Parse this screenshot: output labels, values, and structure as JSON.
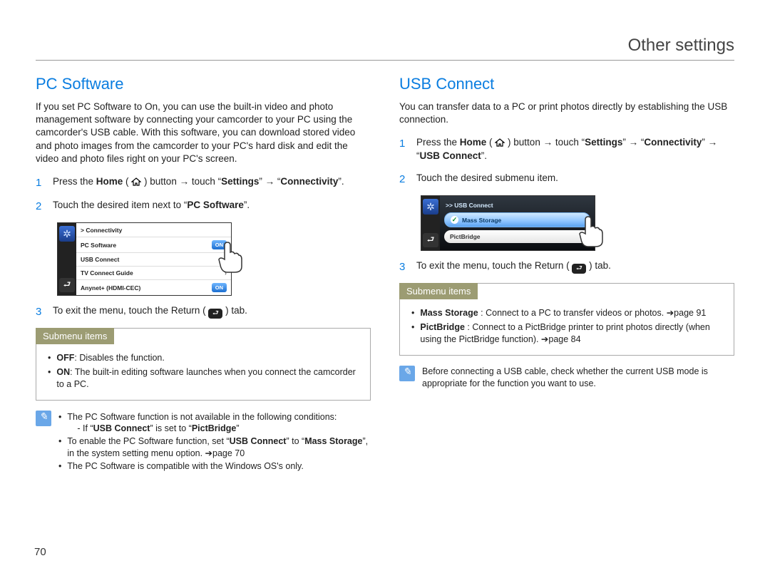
{
  "header": {
    "title": "Other settings"
  },
  "page_number": "70",
  "left": {
    "title": "PC Software",
    "intro": "If you set PC Software to On, you can use the built-in video and photo management software by connecting your camcorder to your PC using the camcorder's USB cable. With this software, you can download stored video and photo images from the camcorder to your PC's hard disk and edit the video and photo files right on your PC's screen.",
    "steps": {
      "s1_num": "1",
      "s1_a": "Press the ",
      "s1_home": "Home",
      "s1_b": " ( ",
      "s1_c": " ) button → touch “",
      "s1_settings": "Settings",
      "s1_d": "” → “",
      "s1_conn": "Connectivity",
      "s1_e": "”.",
      "s2_num": "2",
      "s2_a": "Touch the desired item next to “",
      "s2_pc": "PC Software",
      "s2_b": "”.",
      "s3_num": "3",
      "s3_a": "To exit the menu, touch the Return ( ",
      "s3_b": " ) tab."
    },
    "menu": {
      "crumb": "> Connectivity",
      "rows": {
        "r1": "PC Software",
        "r1_badge": "ON",
        "r2": "USB Connect",
        "r3": "TV Connect Guide",
        "r4": "Anynet+ (HDMI-CEC)",
        "r4_badge": "ON"
      }
    },
    "submenu": {
      "tab": "Submenu items",
      "off_label": "OFF",
      "off_text": ": Disables the function.",
      "on_label": "ON",
      "on_text": ": The built-in editing software launches when you connect the camcorder to a PC."
    },
    "notes": {
      "n1": "The PC Software function is not available in the following conditions:",
      "n1sub_a": "- If “",
      "n1sub_usb": "USB Connect",
      "n1sub_b": "” is set to “",
      "n1sub_pb": "PictBridge",
      "n1sub_c": "”",
      "n2_a": "To enable the PC Software function, set “",
      "n2_usb": "USB Connect",
      "n2_b": "” to “",
      "n2_mass": "Mass Storage",
      "n2_c": "”, in the system setting menu option. ➔page 70",
      "n3": "The PC Software is compatible with the Windows OS's only."
    }
  },
  "right": {
    "title": "USB Connect",
    "intro": "You can transfer data to a PC or print photos directly by establishing the USB connection.",
    "steps": {
      "s1_num": "1",
      "s1_a": "Press the ",
      "s1_home": "Home",
      "s1_b": " ( ",
      "s1_c": " ) button → touch “",
      "s1_settings": "Settings",
      "s1_d": "” → “",
      "s1_conn": "Connectivity",
      "s1_e": "” → “",
      "s1_usb": "USB Connect",
      "s1_f": "”.",
      "s2_num": "2",
      "s2_text": "Touch the desired submenu item.",
      "s3_num": "3",
      "s3_a": "To exit the menu, touch the Return ( ",
      "s3_b": " ) tab."
    },
    "menu": {
      "crumb": ">> USB Connect",
      "opt1": "Mass Storage",
      "opt2": "PictBridge"
    },
    "submenu": {
      "tab": "Submenu items",
      "ms_label": "Mass Storage",
      "ms_text": " : Connect to a PC to transfer videos or photos. ➔page 91",
      "pb_label": "PictBridge",
      "pb_text": " : Connect to a PictBridge printer to print photos directly (when using the PictBridge function). ➔page 84"
    },
    "note": "Before connecting a USB cable, check whether the current USB mode is appropriate for the function you want to use."
  }
}
